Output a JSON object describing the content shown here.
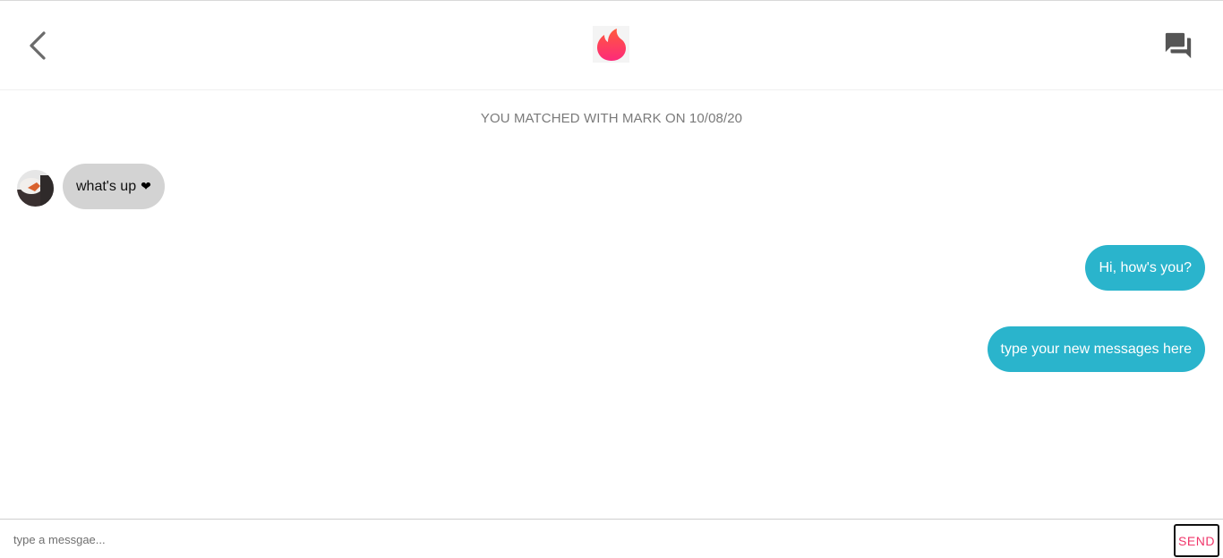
{
  "header": {
    "back_icon": "chevron-left-icon",
    "logo_icon": "tinder-flame-icon",
    "chat_icon": "forum-icon"
  },
  "conversation": {
    "match_notice": "YOU MATCHED WITH MARK ON 10/08/20",
    "incoming": [
      {
        "text": "what's up",
        "emoji": "❤"
      }
    ],
    "outgoing": [
      {
        "text": "Hi, how's you?"
      },
      {
        "text": "type your new messages here"
      }
    ]
  },
  "composer": {
    "placeholder": "type a messgae...",
    "value": "",
    "send_label": "SEND"
  },
  "colors": {
    "brand": "#fd3a73",
    "outgoing_bubble": "#2ab4cc",
    "incoming_bubble": "#d3d3d3",
    "send_text": "#f0366a"
  }
}
